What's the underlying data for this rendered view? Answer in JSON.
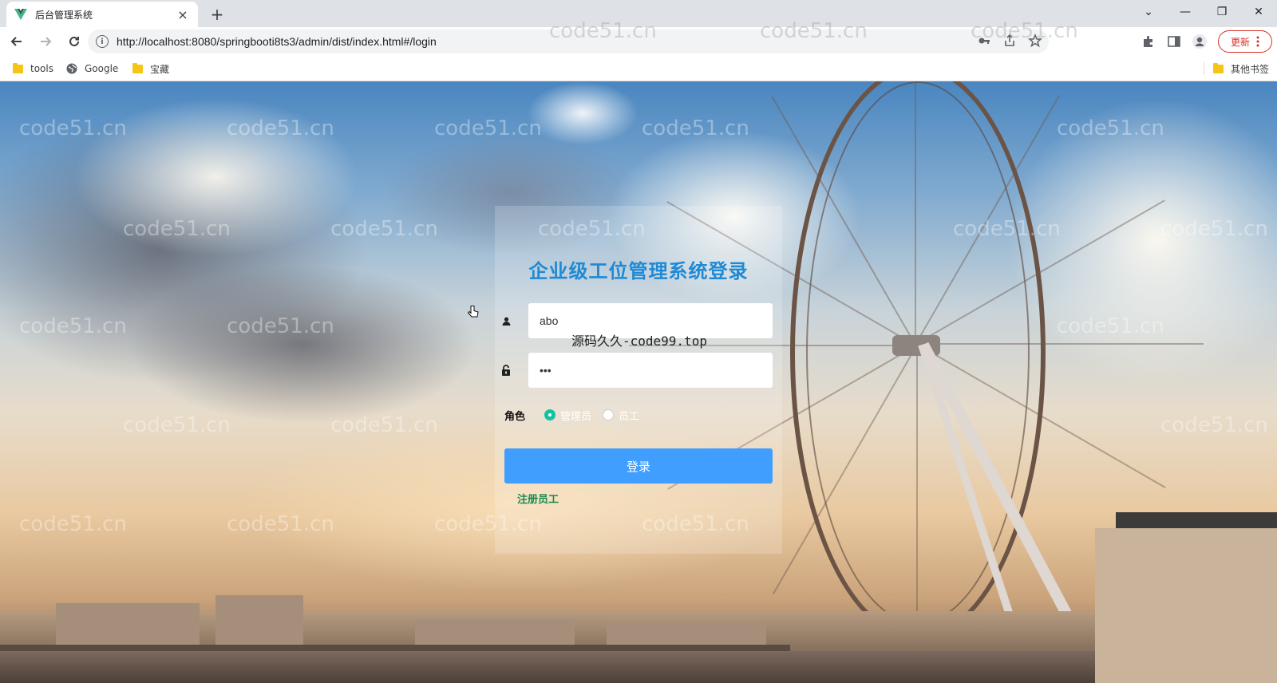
{
  "browser": {
    "tab_title": "后台管理系统",
    "tab_close": "×",
    "new_tab": "+",
    "url": "http://localhost:8080/springbooti8ts3/admin/dist/index.html#/login",
    "update_label": "更新",
    "window": {
      "minimize": "—",
      "restore": "❐",
      "close": "✕",
      "dropdown": "⌄"
    }
  },
  "bookmarks": {
    "items": [
      {
        "label": "tools",
        "icon": "folder-icon"
      },
      {
        "label": "Google",
        "icon": "globe-icon"
      },
      {
        "label": "宝藏",
        "icon": "folder-icon"
      }
    ],
    "other": "其他书签"
  },
  "watermark": "code51.cn",
  "overlay_text": "源码久久-code99.top",
  "login": {
    "title": "企业级工位管理系统登录",
    "username_value": "abo",
    "password_value": "•••",
    "role_label": "角色",
    "roles": [
      {
        "label": "管理员",
        "checked": true
      },
      {
        "label": "员工",
        "checked": false
      }
    ],
    "submit_label": "登录",
    "register_label": "注册员工"
  },
  "colors": {
    "accent": "#409eff",
    "title": "#1e8ad6",
    "radio_checked": "#13c2a0",
    "register_link": "#1a8a52"
  }
}
